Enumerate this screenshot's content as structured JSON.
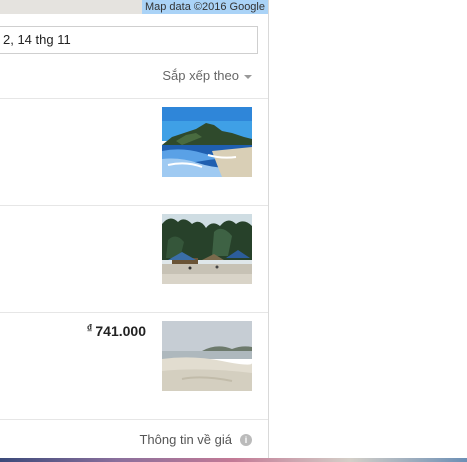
{
  "map": {
    "attribution": "Map data ©2016 Google"
  },
  "search": {
    "date_value": "2, 14 thg 11"
  },
  "sort": {
    "label": "Sắp xếp theo"
  },
  "results": [
    {
      "price": "",
      "thumb": "beach-mountain-sea-photo"
    },
    {
      "price": "",
      "thumb": "beach-trees-huts-photo"
    },
    {
      "currency": "₫",
      "price": "741.000",
      "thumb": "calm-beach-hills-photo"
    }
  ],
  "footer": {
    "text": "Thông tin về giá",
    "icon": "info-icon"
  }
}
